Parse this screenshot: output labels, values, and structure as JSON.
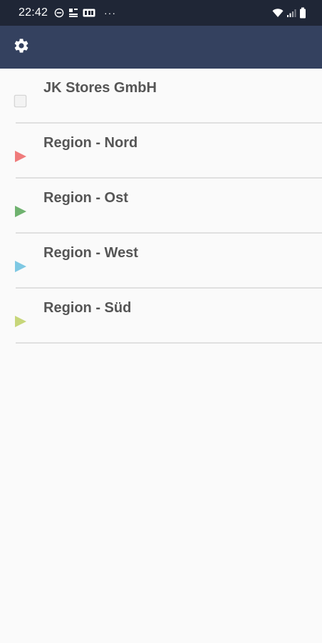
{
  "status_bar": {
    "time": "22:42",
    "icons_left": [
      "dnd-icon",
      "data-saver-icon",
      "hd-icon"
    ],
    "overflow": "···",
    "icons_right": [
      "wifi-icon",
      "signal-icon",
      "battery-icon"
    ]
  },
  "app_bar": {
    "icon": "gear-icon"
  },
  "list": {
    "items": [
      {
        "label": "JK Stores GmbH",
        "icon": "checkbox-icon",
        "color": "#dcdcdc"
      },
      {
        "label": "Region - Nord",
        "icon": "triangle-icon",
        "color": "#ef7b7b"
      },
      {
        "label": "Region - Ost",
        "icon": "triangle-icon",
        "color": "#6fb26f"
      },
      {
        "label": "Region - West",
        "icon": "triangle-icon",
        "color": "#7ec8e3"
      },
      {
        "label": "Region - Süd",
        "icon": "triangle-icon",
        "color": "#c7d67a"
      }
    ]
  },
  "colors": {
    "status_bar_bg": "#1f2636",
    "app_bar_bg": "#34415f",
    "background": "#fafafa",
    "text": "#555555",
    "divider": "#e0e0e0"
  }
}
